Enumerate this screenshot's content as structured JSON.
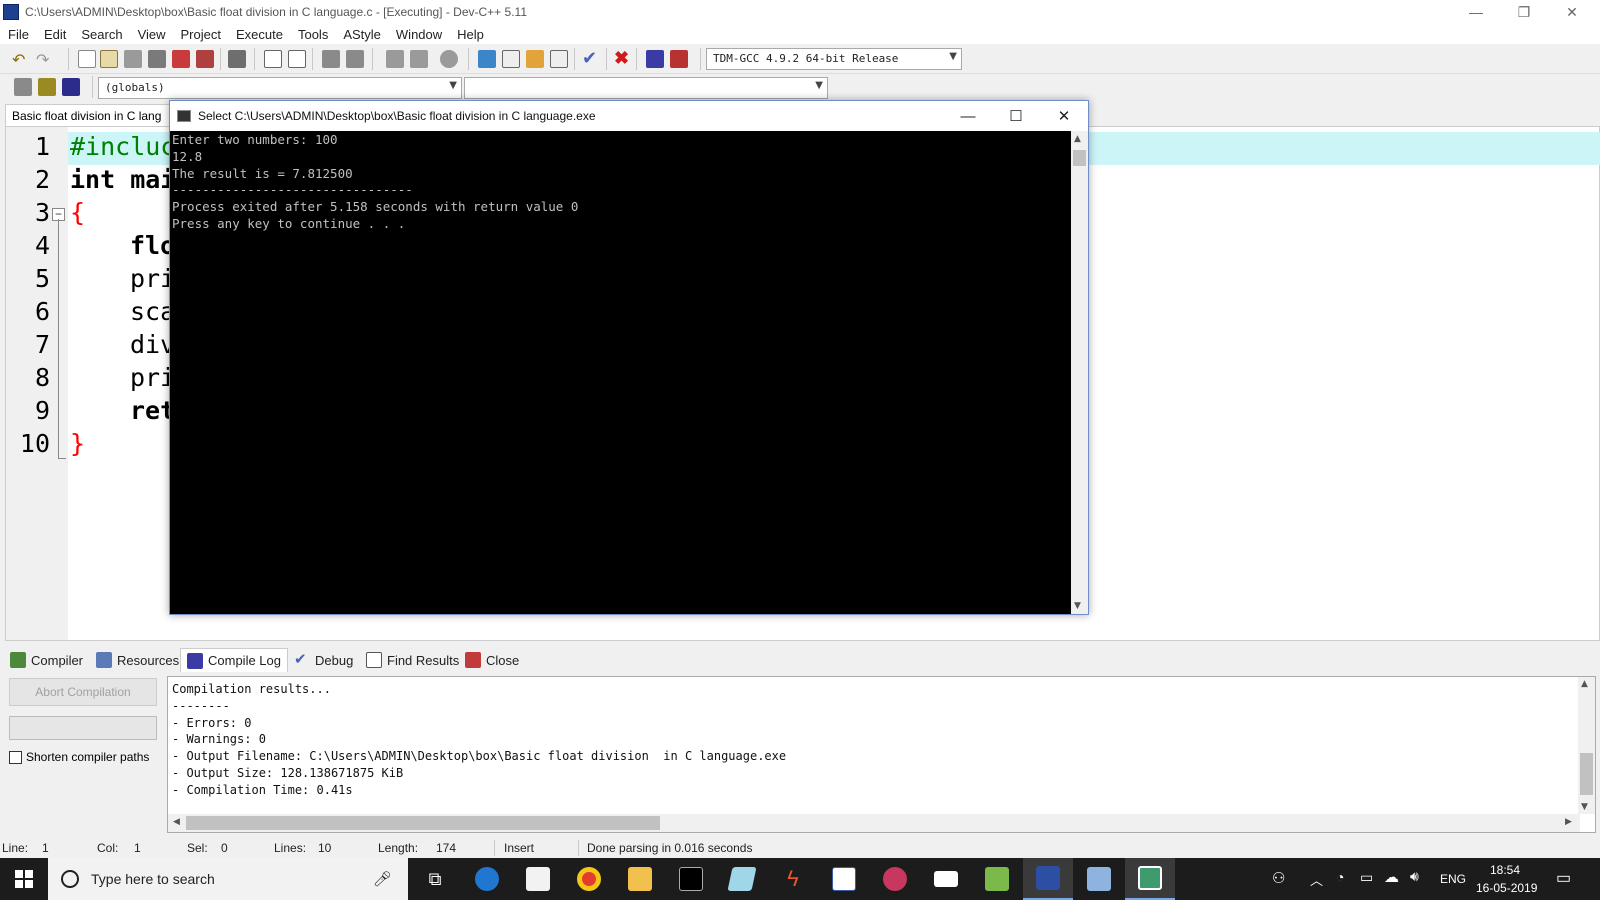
{
  "window": {
    "title": "C:\\Users\\ADMIN\\Desktop\\box\\Basic float division  in C language.c - [Executing] - Dev-C++ 5.11",
    "minimize": "—",
    "restore": "❐",
    "close": "✕"
  },
  "menu": [
    "File",
    "Edit",
    "Search",
    "View",
    "Project",
    "Execute",
    "Tools",
    "AStyle",
    "Window",
    "Help"
  ],
  "toolbar": {
    "compiler_select": "TDM-GCC 4.9.2 64-bit Release",
    "scope_select": "(globals)",
    "function_select": ""
  },
  "editor": {
    "tab_label": "Basic float division  in C lang",
    "line_numbers": [
      "1",
      "2",
      "3",
      "4",
      "5",
      "6",
      "7",
      "8",
      "9",
      "10"
    ],
    "visible_code": [
      "#incluc",
      "int mai",
      "{",
      "flo",
      "pri",
      "sca",
      "div",
      "pri",
      "ret",
      "}"
    ]
  },
  "console": {
    "title": "Select C:\\Users\\ADMIN\\Desktop\\box\\Basic float division  in C language.exe",
    "lines": [
      "Enter two numbers: 100",
      "12.8",
      "The result is = 7.812500",
      "--------------------------------",
      "Process exited after 5.158 seconds with return value 0",
      "Press any key to continue . . ."
    ]
  },
  "bottom_tabs": [
    "Compiler",
    "Resources",
    "Compile Log",
    "Debug",
    "Find Results",
    "Close"
  ],
  "compile_panel": {
    "abort_button": "Abort Compilation",
    "shorten_paths_label": "Shorten compiler paths",
    "shorten_paths_checked": false,
    "log": [
      "Compilation results...",
      "--------",
      "- Errors: 0",
      "- Warnings: 0",
      "- Output Filename: C:\\Users\\ADMIN\\Desktop\\box\\Basic float division  in C language.exe",
      "- Output Size: 128.138671875 KiB",
      "- Compilation Time: 0.41s"
    ]
  },
  "status": {
    "line_label": "Line:",
    "line_value": "1",
    "col_label": "Col:",
    "col_value": "1",
    "sel_label": "Sel:",
    "sel_value": "0",
    "lines_label": "Lines:",
    "lines_value": "10",
    "length_label": "Length:",
    "length_value": "174",
    "mode": "Insert",
    "message": "Done parsing in 0.016 seconds"
  },
  "taskbar": {
    "search_placeholder": "Type here to search",
    "language": "ENG",
    "time": "18:54",
    "date": "16-05-2019"
  },
  "colors": {
    "keyword": "#000000",
    "preprocessor": "#008000",
    "brace": "#ff0000",
    "current_line": "#ccf5f8",
    "console_bg": "#000000",
    "console_text": "#c0c0c0"
  }
}
